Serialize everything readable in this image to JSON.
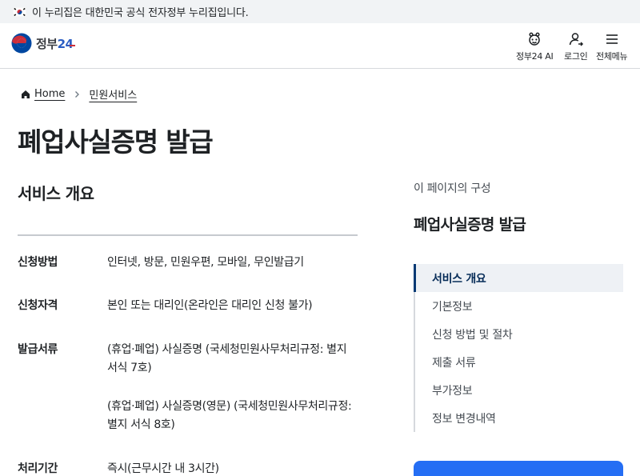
{
  "gov_banner": {
    "text": "이 누리집은 대한민국 공식 전자정부 누리집입니다.",
    "flag_icon": "korea-flag-icon"
  },
  "header": {
    "logo": {
      "text": "정부",
      "number": "24",
      "icon": "taegeuk-logo-icon"
    },
    "buttons": [
      {
        "label": "정부24 AI",
        "icon": "ai-assistant-icon"
      },
      {
        "label": "로그인",
        "icon": "user-login-icon"
      },
      {
        "label": "전체메뉴",
        "icon": "hamburger-menu-icon"
      }
    ]
  },
  "breadcrumb": {
    "home_label": "Home",
    "home_icon": "home-icon",
    "separator_icon": "chevron-right-icon",
    "current_label": "민원서비스"
  },
  "page_title": "폐업사실증명 발급",
  "service_overview": {
    "heading": "서비스 개요",
    "rows": [
      {
        "label": "신청방법",
        "values": [
          "인터넷, 방문, 민원우편, 모바일, 무인발급기"
        ]
      },
      {
        "label": "신청자격",
        "values": [
          "본인 또는 대리인(온라인은 대리인 신청 불가)"
        ]
      },
      {
        "label": "발급서류",
        "values": [
          "(휴업·폐업) 사실증명 (국세청민원사무처리규정: 별지 서식 7호)",
          "(휴업·폐업) 사실증명(영문) (국세청민원사무처리규정: 별지 서식 8호)"
        ]
      },
      {
        "label": "처리기간",
        "values": [
          "즉시(근무시간 내 3시간)"
        ]
      }
    ]
  },
  "toc": {
    "caption": "이 페이지의 구성",
    "title": "폐업사실증명 발급",
    "items": [
      {
        "label": "서비스 개요",
        "active": true
      },
      {
        "label": "기본정보",
        "active": false
      },
      {
        "label": "신청 방법 및 절차",
        "active": false
      },
      {
        "label": "제출 서류",
        "active": false
      },
      {
        "label": "부가정보",
        "active": false
      },
      {
        "label": "정보 변경내역",
        "active": false
      }
    ]
  },
  "colors": {
    "brand_blue": "#256ef4",
    "toc_active_bar": "#063a74",
    "banner_bg": "#f1f3f5"
  }
}
